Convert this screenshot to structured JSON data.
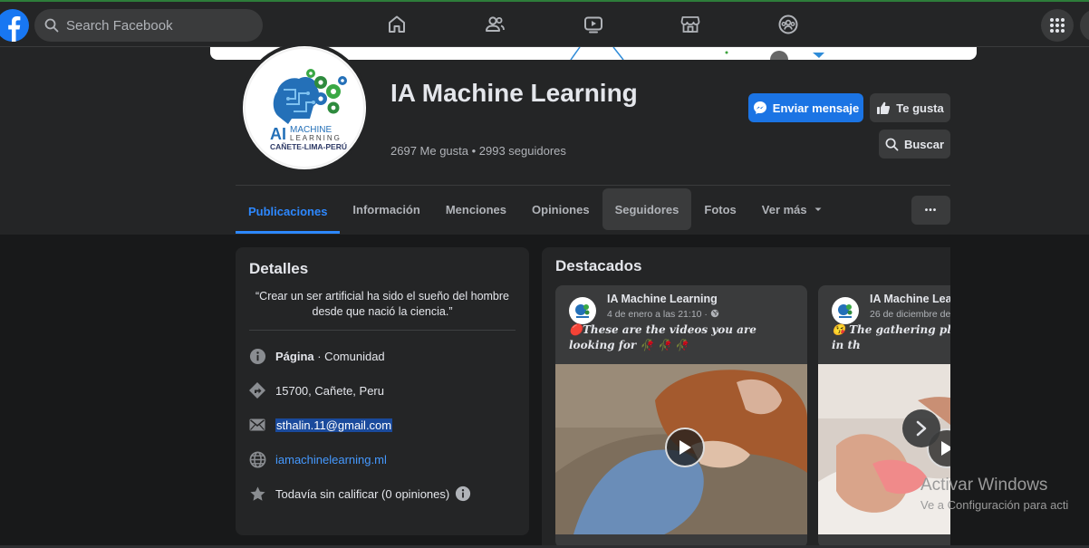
{
  "topbar": {
    "search_placeholder": "Search Facebook",
    "nav_icons": [
      "home-icon",
      "friends-icon",
      "watch-icon",
      "marketplace-icon",
      "groups-icon"
    ],
    "menu_icon": "apps-grid-icon"
  },
  "profile": {
    "logo_line1": "MACHINE",
    "logo_line2": "LEARNING",
    "logo_line3": "CAÑETE-LIMA-PERÚ",
    "logo_ai": "AI",
    "name": "IA Machine Learning",
    "stats": "2697 Me gusta • 2993 seguidores"
  },
  "actions": {
    "message": "Enviar mensaje",
    "like": "Te gusta",
    "search": "Buscar"
  },
  "tabs": [
    "Publicaciones",
    "Información",
    "Menciones",
    "Opiniones",
    "Seguidores",
    "Fotos",
    "Ver más"
  ],
  "more_label": "•••",
  "details": {
    "title": "Detalles",
    "quote": "“Crear un ser artificial ha sido el sueño del hombre desde que nació la ciencia.”",
    "category_bold": "Página",
    "category_rest": " · Comunidad",
    "location": "15700, Cañete, Peru",
    "email": "sthalin.11@gmail.com",
    "website": "iamachinelearning.ml",
    "rating": "Todavía sin calificar (0 opiniones)"
  },
  "featured": {
    "title": "Destacados",
    "posts": [
      {
        "author": "IA Machine Learning",
        "date": "4 de enero a las 21:10 · ",
        "text": "🔴These are the videos you are looking for 🥀 🥀 🥀"
      },
      {
        "author": "IA Machine Learning",
        "date": "26 de diciembre de",
        "text": "😘 The gathering pla beautiful girls in th"
      }
    ]
  },
  "watermark": {
    "line1": "Activar Windows",
    "line2": "Ve a Configuración para acti"
  },
  "colors": {
    "background": "#18191a",
    "surface": "#242526",
    "accent": "#2d88ff",
    "primary_button": "#1b74e4"
  }
}
